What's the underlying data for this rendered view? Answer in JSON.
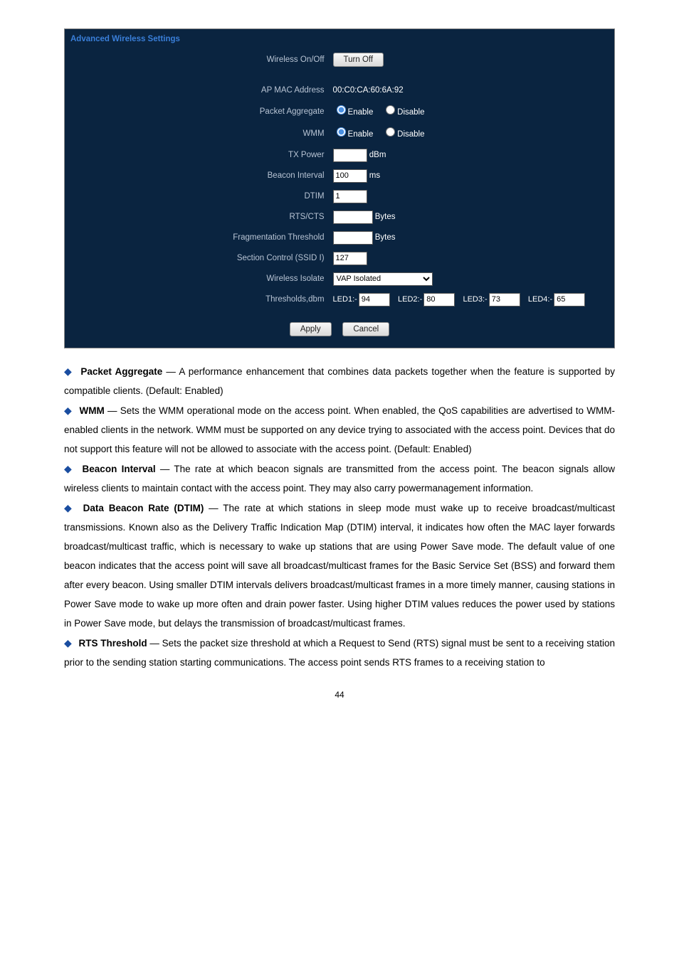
{
  "panel": {
    "header": "Advanced Wireless Settings",
    "wireless_on_off_label": "Wireless On/Off",
    "turn_off_btn": "Turn Off",
    "ap_mac_label": "AP MAC Address",
    "ap_mac_value": "00:C0:CA:60:6A:92",
    "packet_aggregate_label": "Packet Aggregate",
    "wmm_label": "WMM",
    "enable_label": "Enable",
    "disable_label": "Disable",
    "tx_power_label": "TX Power",
    "tx_power_unit": "dBm",
    "beacon_interval_label": "Beacon Interval",
    "beacon_interval_value": "100",
    "beacon_interval_unit": "ms",
    "dtim_label": "DTIM",
    "dtim_value": "1",
    "rtscts_label": "RTS/CTS",
    "rtscts_value": "",
    "rtscts_unit": "Bytes",
    "frag_label": "Fragmentation Threshold",
    "frag_value": "",
    "frag_unit": "Bytes",
    "section_control_label": "Section Control (SSID I)",
    "section_control_value": "127",
    "isolate_label": "Wireless Isolate",
    "isolate_value": "VAP Isolated",
    "thresholds_label": "Thresholds,dbm",
    "led1_label": "LED1:-",
    "led1_value": "94",
    "led2_label": "LED2:-",
    "led2_value": "80",
    "led3_label": "LED3:-",
    "led3_value": "73",
    "led4_label": "LED4:-",
    "led4_value": "65",
    "apply_btn": "Apply",
    "cancel_btn": "Cancel"
  },
  "body": {
    "p1a": "Packet Aggregate",
    "p1b": " — A performance enhancement that combines data packets together when the feature is supported by compatible clients. (Default: Enabled)",
    "p2a": "WMM",
    "p2b": " — Sets the WMM operational mode on the access point. When enabled, the QoS capabilities are advertised to WMM-enabled clients in the network. WMM must be supported on any device trying to associated with the access point. Devices that do not support this feature will not be allowed to associate with the access point. (Default: Enabled)",
    "p3a": "Beacon Interval",
    "p3b": " — The rate at which beacon signals are transmitted from the access point. The beacon signals allow wireless clients to maintain contact with the access point. They may also carry powermanagement information.",
    "p4a": "Data Beacon Rate (DTIM)",
    "p4b": " — The rate at which stations in sleep mode must wake up to receive broadcast/multicast transmissions. Known also as the Delivery Traffic Indication Map (DTIM) interval, it indicates how often the MAC layer forwards broadcast/multicast traffic, which is necessary to wake up stations that are using Power Save mode. The default value of one beacon indicates that the access point will save all broadcast/multicast frames for the Basic Service Set (BSS) and forward them after every beacon. Using smaller DTIM intervals delivers broadcast/multicast frames in a more timely manner, causing stations in Power Save mode to wake up more often and drain power faster. Using higher DTIM values reduces the power used by stations in Power Save mode, but delays the transmission of broadcast/multicast frames.",
    "p5a": "RTS Threshold",
    "p5b": " — Sets the packet size threshold at which a Request to Send (RTS) signal must be sent to a receiving station prior to the sending station starting communications. The access point sends RTS frames to a receiving station to"
  },
  "page_number": "44"
}
